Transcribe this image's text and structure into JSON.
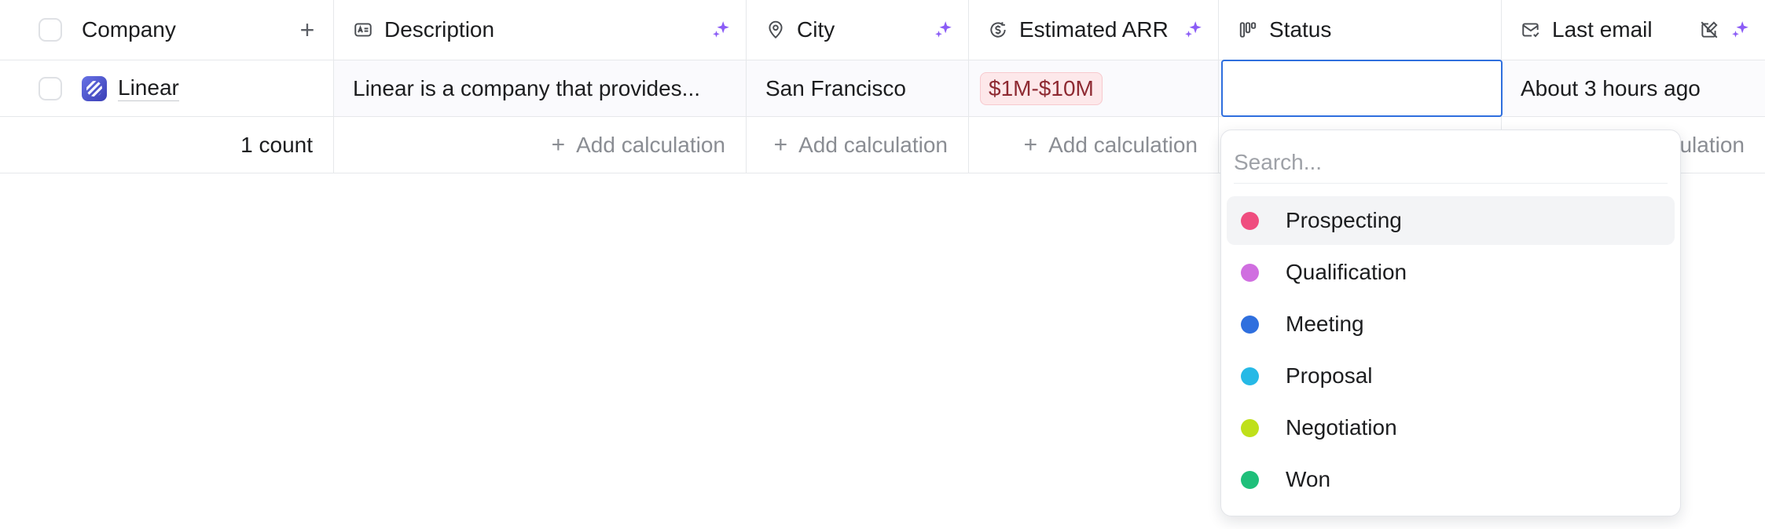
{
  "columns": [
    {
      "key": "company",
      "label": "Company",
      "icon": "plus-icon"
    },
    {
      "key": "description",
      "label": "Description",
      "icon": "text-card-icon"
    },
    {
      "key": "city",
      "label": "City",
      "icon": "map-pin-icon"
    },
    {
      "key": "estimated_arr",
      "label": "Estimated ARR",
      "icon": "currency-cycle-icon"
    },
    {
      "key": "status",
      "label": "Status",
      "icon": "kanban-icon"
    },
    {
      "key": "last_email",
      "label": "Last email",
      "icon": "mail-icon"
    }
  ],
  "rows": [
    {
      "company": "Linear",
      "description": "Linear is a company that provides...",
      "city": "San Francisco",
      "estimated_arr": "$1M-$10M",
      "status": "",
      "last_email": "About 3 hours ago"
    }
  ],
  "footer": {
    "count_label": "1 count",
    "add_calculation_label": "Add calculation",
    "last_partial": "ulation"
  },
  "status_dropdown": {
    "search_placeholder": "Search...",
    "options": [
      {
        "label": "Prospecting",
        "color": "#ef4d7f"
      },
      {
        "label": "Qualification",
        "color": "#d06ee0"
      },
      {
        "label": "Meeting",
        "color": "#2f6fde"
      },
      {
        "label": "Proposal",
        "color": "#26b9e6"
      },
      {
        "label": "Negotiation",
        "color": "#bfe01a"
      },
      {
        "label": "Won",
        "color": "#1fbf7a"
      }
    ]
  },
  "colors": {
    "accent": "#2f6fde",
    "ai_sparkle": "#8b5cf6",
    "arr_badge_bg": "#fde8ea",
    "arr_badge_text": "#8e2a32"
  }
}
